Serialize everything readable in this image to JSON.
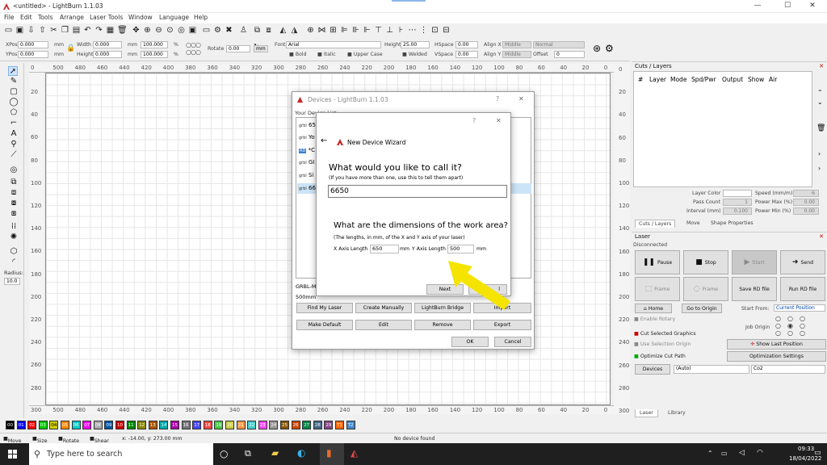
{
  "window": {
    "title": "<untitled> - LightBurn 1.1.03",
    "min": "—",
    "max": "☐",
    "close": "✕"
  },
  "menu": [
    "File",
    "Edit",
    "Tools",
    "Arrange",
    "Laser Tools",
    "Window",
    "Language",
    "Help"
  ],
  "toolbar2": {
    "xpos_label": "XPos",
    "xpos": "0.000",
    "ypos_label": "YPos",
    "ypos": "0.000",
    "unit": "mm",
    "width_label": "Width",
    "width": "0.000",
    "height_label": "Height",
    "height": "0.000",
    "wpct": "100.000",
    "hpct": "100.000",
    "pct": "%",
    "rotate_label": "Rotate",
    "rotate": "0.00",
    "mm_btn": "mm",
    "font_label": "Font",
    "font": "Arial",
    "fheight_label": "Height",
    "fheight": "25.00",
    "hspace_label": "HSpace",
    "hspace": "0.00",
    "vspace_label": "VSpace",
    "vspace": "0.00",
    "bold": "Bold",
    "italic": "Italic",
    "upper": "Upper Case",
    "welded": "Welded",
    "alignx_label": "Align X",
    "alignx": "Middle",
    "aligny_label": "Align Y",
    "aligny": "Middle",
    "normal": "Normal",
    "offset_label": "Offset",
    "offset": "0"
  },
  "rulers": {
    "top": [
      "0",
      "500",
      "480",
      "460",
      "440",
      "420",
      "400",
      "380",
      "360",
      "340",
      "320",
      "300",
      "280",
      "260",
      "240",
      "220",
      "200",
      "180",
      "160",
      "140",
      "120",
      "100",
      "80",
      "60",
      "40",
      "20",
      "0"
    ],
    "bottom": [
      "300",
      "500",
      "480",
      "460",
      "440",
      "420",
      "400",
      "380",
      "360",
      "340",
      "320",
      "300",
      "280",
      "260",
      "240",
      "220",
      "200",
      "180",
      "160",
      "140",
      "120",
      "100",
      "80",
      "60",
      "40",
      "20",
      "0"
    ],
    "left": [
      "20",
      "40",
      "60",
      "80",
      "100",
      "120",
      "140",
      "160",
      "180",
      "200",
      "220",
      "240",
      "260",
      "280"
    ],
    "right": [
      "0",
      "20",
      "40",
      "60",
      "80",
      "100",
      "120",
      "140",
      "160",
      "180",
      "200",
      "220",
      "240",
      "260",
      "280",
      "300"
    ]
  },
  "lefttools": {
    "radius_label": "Radius:",
    "radius": "10.0"
  },
  "palette": [
    "00",
    "01",
    "02",
    "03",
    "04",
    "05",
    "06",
    "07",
    "08",
    "09",
    "10",
    "11",
    "12",
    "13",
    "14",
    "15",
    "16",
    "17",
    "18",
    "19",
    "20",
    "21",
    "22",
    "23",
    "24",
    "25",
    "26",
    "27",
    "28",
    "29",
    "T1",
    "T2"
  ],
  "palette_colors": [
    "#000000",
    "#0000ff",
    "#ff0000",
    "#00cc00",
    "#cccc00",
    "#ff8800",
    "#00cccc",
    "#ff00ff",
    "#aaaaaa",
    "#0055aa",
    "#cc0000",
    "#008800",
    "#888800",
    "#aa5500",
    "#00aaaa",
    "#aa00aa",
    "#777777",
    "#4444ff",
    "#ff4444",
    "#44cc44",
    "#cccc44",
    "#ff9944",
    "#44cccc",
    "#ff44ff",
    "#999999",
    "#885500",
    "#cc4400",
    "#008844",
    "#446688",
    "#884488",
    "#ff6600",
    "#4488cc"
  ],
  "status": {
    "move": "Move",
    "size": "Size",
    "rotate": "Rotate",
    "shear": "Shear",
    "coords": "x: -14.00, y: 273.00 mm",
    "device": "No device found"
  },
  "cuts": {
    "title": "Cuts / Layers",
    "cols": [
      "#",
      "Layer",
      "Mode",
      "Spd/Pwr",
      "Output",
      "Show",
      "Air"
    ],
    "layer_color": "Layer Color",
    "speed": "Speed (mm/m)",
    "speed_val": "6",
    "pass": "Pass Count",
    "pass_val": "1",
    "pmax": "Power Max (%)",
    "pmax_val": "0.00",
    "interval": "Interval (mm)",
    "interval_val": "0.100",
    "pmin": "Power Min (%)",
    "pmin_val": "0.00",
    "tabs": [
      "Cuts / Layers",
      "Move",
      "Shape Properties"
    ]
  },
  "laser": {
    "title": "Laser",
    "status": "Disconnected",
    "pause": "Pause",
    "stop": "Stop",
    "start": "Start",
    "send": "Send",
    "frame1": "Frame",
    "frame2": "Frame",
    "save_rd": "Save RD file",
    "run_rd": "Run RD file",
    "home": "Home",
    "goto": "Go to Origin",
    "start_from": "Start From:",
    "start_from_val": "Current Position",
    "rotary": "Enable Rotary",
    "job_origin": "Job Origin",
    "cut_selected": "Cut Selected Graphics",
    "use_sel": "Use Selection Origin",
    "show_last": "Show Last Position",
    "optimize": "Optimize Cut Path",
    "opt_settings": "Optimization Settings",
    "devices": "Devices",
    "auto": "(Auto)",
    "co2": "Co2",
    "tabs": [
      "Laser",
      "Library"
    ]
  },
  "devices_dialog": {
    "title": "Devices - LightBurn 1.1.03",
    "help": "?",
    "close": "✕",
    "list_label": "Your Device List",
    "items": [
      "65",
      "Yo",
      "*C",
      "GI",
      "Si",
      "66"
    ],
    "grbl": "GRBL-M:",
    "size": "500mm",
    "row1": [
      "Find My Laser",
      "Create Manually",
      "LightBurn Bridge",
      "Import"
    ],
    "row2": [
      "Make Default",
      "Edit",
      "Remove",
      "Export"
    ],
    "ok": "OK",
    "cancel": "Cancel"
  },
  "wizard": {
    "help": "?",
    "close": "✕",
    "back": "←",
    "title": "New Device Wizard",
    "q1": "What would you like to call it?",
    "q1_sub": "(If you have more than one, use this to tell them apart)",
    "name": "6650",
    "q2": "What are the dimensions of the work area?",
    "q2_sub": "(The lengths, in mm, of the X and Y axis of your laser)",
    "x_label": "X Axis Length",
    "x_val": "650",
    "x_unit": "mm",
    "y_label": "Y Axis Length",
    "y_val": "500",
    "y_unit": "mm",
    "next": "Next",
    "cancel": "l"
  },
  "taskbar": {
    "search": "Type here to search",
    "time": "09:33",
    "date": "18/04/2022"
  },
  "colors": {
    "arrow": "#f5e400",
    "lightburn_red": "#c62828"
  }
}
